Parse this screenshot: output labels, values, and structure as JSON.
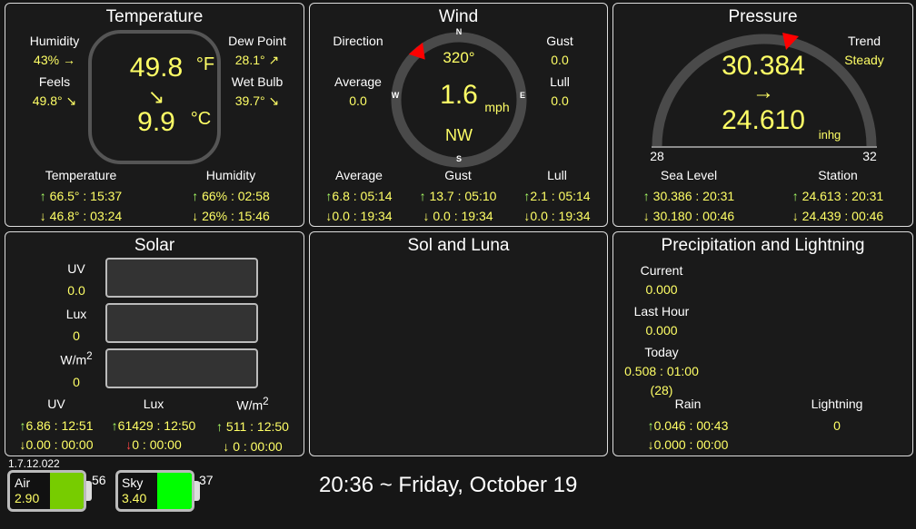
{
  "temperature": {
    "title": "Temperature",
    "humidity_label": "Humidity",
    "humidity": "43% →",
    "feels_label": "Feels",
    "feels": "49.8° ↘",
    "dew_label": "Dew Point",
    "dew": "28.1° ↗",
    "wet_label": "Wet Bulb",
    "wet": "39.7° ↘",
    "temp_f": "49.8",
    "unit_f": "°F",
    "trend": "↘",
    "temp_c": "9.9",
    "unit_c": "°C",
    "stats_temp_label": "Temperature",
    "stats_hum_label": "Humidity",
    "temp_high": "66.5° : 15:37",
    "temp_low": "46.8° : 03:24",
    "hum_high": "66% : 02:58",
    "hum_low": "26% : 15:46"
  },
  "wind": {
    "title": "Wind",
    "direction_label": "Direction",
    "average_label": "Average",
    "average": "0.0",
    "gust_label": "Gust",
    "gust": "0.0",
    "lull_label": "Lull",
    "lull": "0.0",
    "degrees": "320°",
    "speed": "1.6",
    "unit": "mph",
    "cardinal": "NW",
    "compass": {
      "n": "N",
      "e": "E",
      "s": "S",
      "w": "W"
    },
    "stats_avg_label": "Average",
    "stats_gust_label": "Gust",
    "stats_lull_label": "Lull",
    "avg_high": "6.8 : 05:14",
    "avg_low": "0.0 : 19:34",
    "gust_high": "13.7 : 05:10",
    "gust_low": "0.0 : 19:34",
    "lull_high": "2.1 : 05:14",
    "lull_low": "0.0 : 19:34",
    "marker": "0"
  },
  "pressure": {
    "title": "Pressure",
    "trend_label": "Trend",
    "trend": "Steady",
    "sea_level": "30.384",
    "arrow": "→",
    "station": "24.610",
    "unit": "inhg",
    "gauge_min": "28",
    "gauge_max": "32",
    "marker": "0",
    "sea_label": "Sea Level",
    "station_label": "Station",
    "sea_high": "30.386 : 20:31",
    "sea_low": "30.180 : 00:46",
    "station_high": "24.613 : 20:31",
    "station_low": "24.439 : 00:46"
  },
  "solar": {
    "title": "Solar",
    "uv_label": "UV",
    "uv": "0.0",
    "lux_label": "Lux",
    "lux": "0",
    "wm_label": "W/m",
    "wm_sup": "2",
    "wm": "0",
    "uv_high": "6.86 : 12:51",
    "uv_low": "0.00 : 00:00",
    "lux_high": "61429 : 12:50",
    "lux_low": "0 : 00:00",
    "wm_high": "511 : 12:50",
    "wm_low": "0 : 00:00"
  },
  "sol_luna": {
    "title": "Sol and Luna"
  },
  "precip": {
    "title": "Precipitation and Lightning",
    "current_label": "Current",
    "current": "0.000",
    "last_hour_label": "Last Hour",
    "last_hour": "0.000",
    "today_label": "Today",
    "today": "0.508 : 01:00",
    "today_count": "(28)",
    "rain_label": "Rain",
    "rain_high": "0.046 : 00:43",
    "rain_low": "0.000 : 00:00",
    "lightning_label": "Lightning",
    "lightning": "0"
  },
  "footer": {
    "version": "1.7.12.022",
    "air_label": "Air",
    "air_voltage": "2.90",
    "air_level": "56",
    "sky_label": "Sky",
    "sky_voltage": "3.40",
    "sky_level": "37",
    "datetime": "20:36 ~ Friday, October 19"
  },
  "arrows": {
    "up": "↑",
    "down": "↓"
  },
  "colors": {
    "value": "#ffff66",
    "up": "#aaff66",
    "air_fill": "#77cc00",
    "sky_fill": "#00ff00",
    "marker": "#ff0000"
  }
}
